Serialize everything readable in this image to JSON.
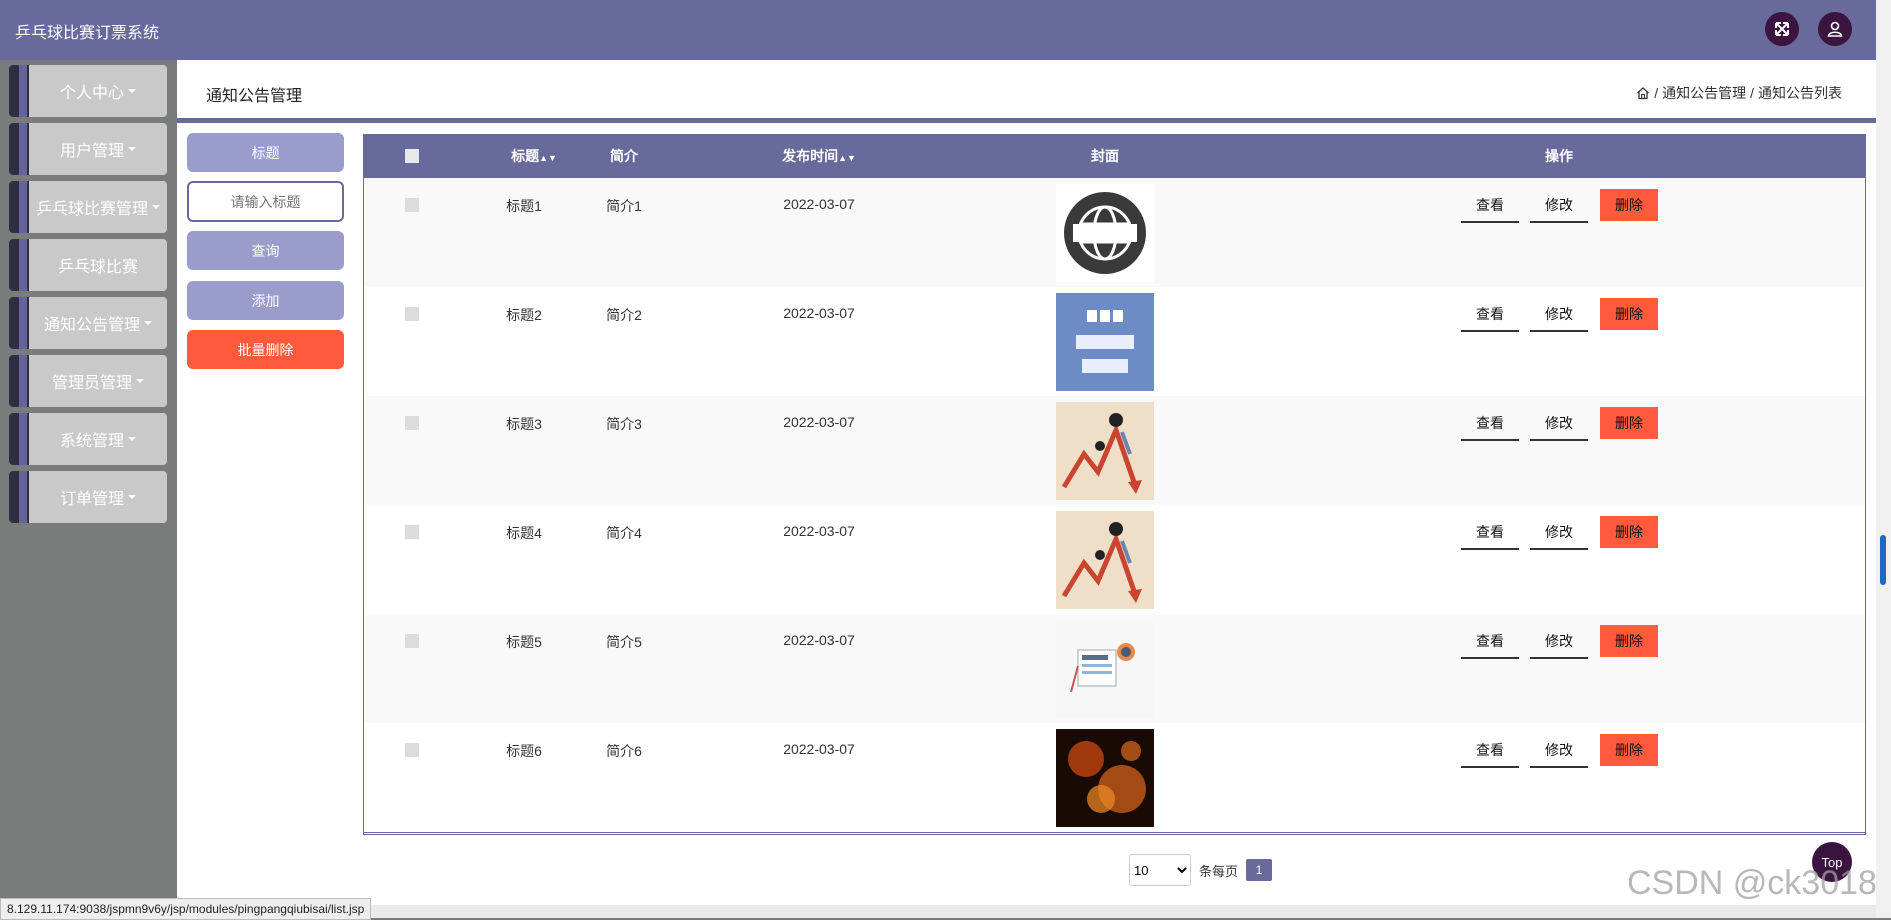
{
  "app": {
    "title": "乒乓球比赛订票系统"
  },
  "topbar": {
    "fullscreen_icon": "expand-icon",
    "user_icon": "user-icon"
  },
  "sidebar": {
    "items": [
      {
        "label": "个人中心",
        "has_caret": true
      },
      {
        "label": "用户管理",
        "has_caret": true
      },
      {
        "label": "乒乓球比赛管理",
        "has_caret": true
      },
      {
        "label": "乒乓球比赛",
        "has_caret": false
      },
      {
        "label": "通知公告管理",
        "has_caret": true
      },
      {
        "label": "管理员管理",
        "has_caret": true
      },
      {
        "label": "系统管理",
        "has_caret": true
      },
      {
        "label": "订单管理",
        "has_caret": true
      }
    ]
  },
  "header": {
    "title": "通知公告管理",
    "breadcrumb": [
      "通知公告管理",
      "通知公告列表"
    ],
    "separator": "/"
  },
  "left_panel": {
    "label_button": "标题",
    "search_placeholder": "请输入标题",
    "search_button": "查询",
    "add_button": "添加",
    "batch_delete_button": "批量删除"
  },
  "table": {
    "columns": [
      "标题",
      "简介",
      "发布时间",
      "封面",
      "操作"
    ],
    "rows": [
      {
        "title": "标题1",
        "intro": "简介1",
        "date": "2022-03-07",
        "cover": "news-globe"
      },
      {
        "title": "标题2",
        "intro": "简介2",
        "date": "2022-03-07",
        "cover": "bbc-world-news"
      },
      {
        "title": "标题3",
        "intro": "简介3",
        "date": "2022-03-07",
        "cover": "falling-arrow"
      },
      {
        "title": "标题4",
        "intro": "简介4",
        "date": "2022-03-07",
        "cover": "falling-arrow"
      },
      {
        "title": "标题5",
        "intro": "简介5",
        "date": "2022-03-07",
        "cover": "news-paper"
      },
      {
        "title": "标题6",
        "intro": "简介6",
        "date": "2022-03-07",
        "cover": "currency-fire"
      }
    ],
    "actions": {
      "view": "查看",
      "edit": "修改",
      "delete": "删除"
    }
  },
  "pager": {
    "page_size": "10",
    "per_page_label": "条每页",
    "current_page": "1"
  },
  "top_button": "Top",
  "status_url": "8.129.11.174:9038/jspmn9v6y/jsp/modules/pingpangqiubisai/list.jsp",
  "watermark": "CSDN @ck3018",
  "colors": {
    "primary": "#676a9a",
    "danger": "#ff5a3c",
    "light_button": "#9a9dcc"
  }
}
